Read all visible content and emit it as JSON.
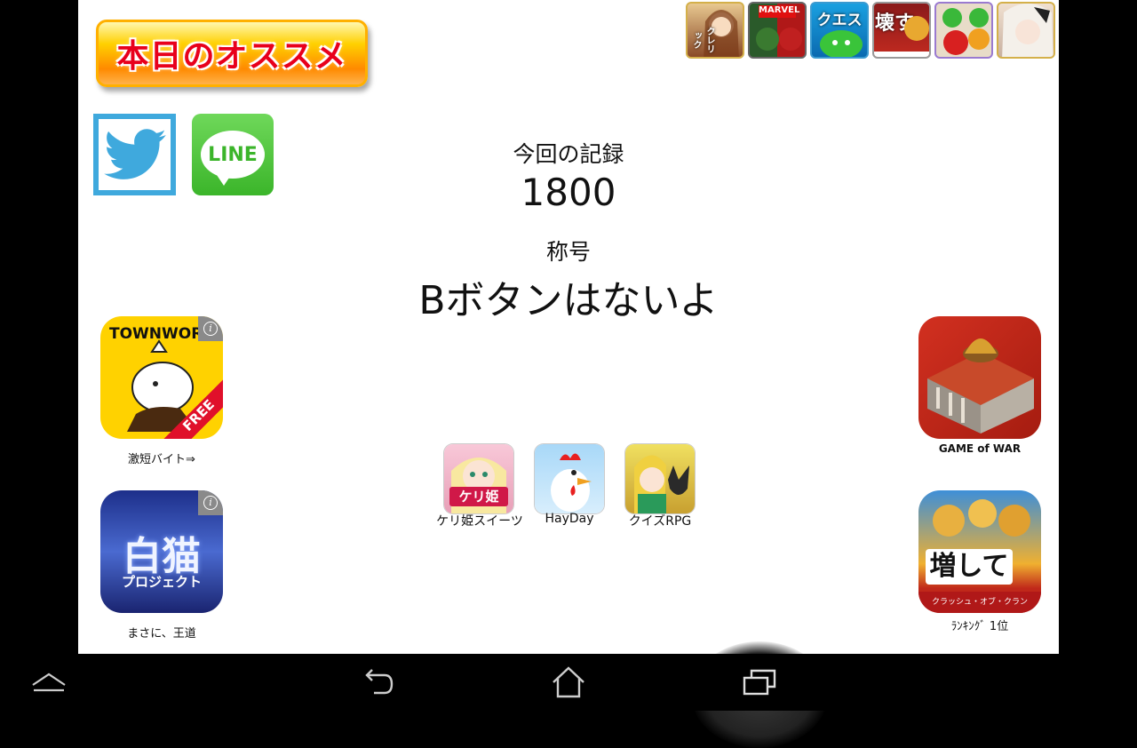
{
  "banner": {
    "text": "本日のオススメ"
  },
  "top_icons": [
    {
      "name": "cleric",
      "label": "クレリック"
    },
    {
      "name": "marvel",
      "label": "MARVEL"
    },
    {
      "name": "puyo-quest",
      "label": "クエスト"
    },
    {
      "name": "clash-break",
      "label": "壊す"
    },
    {
      "name": "puzzle-orbs",
      "label": ""
    },
    {
      "name": "gothic-girl",
      "label": ""
    }
  ],
  "social": {
    "twitter": "twitter-bird-icon",
    "line_label": "LINE"
  },
  "result": {
    "record_label": "今回の記録",
    "record_value": "1800",
    "title_label": "称号",
    "title_value": "Bボタンはないよ"
  },
  "ads": {
    "townwork": {
      "logo": "TOWNWORK",
      "badge": "FREE",
      "caption": "激短バイト⇒"
    },
    "shironeko": {
      "logo": "白猫",
      "sub": "プロジェクト",
      "caption": "まさに、王道"
    },
    "gameofwar": {
      "caption": "GAME of WAR"
    },
    "clash": {
      "logo": "増して",
      "sub": "クラッシュ・オブ・クラン",
      "caption": "ﾗﾝｷﾝｸﾞ 1位"
    }
  },
  "small_apps": [
    {
      "label": "ケリ姫",
      "caption": "ケリ姫スイーツ"
    },
    {
      "label": "",
      "caption": "HayDay"
    },
    {
      "label": "",
      "caption": "クイズRPG"
    }
  ],
  "colors": {
    "banner_red": "#e8001c",
    "twitter_blue": "#3fa9dd",
    "line_green": "#3bb52a"
  }
}
